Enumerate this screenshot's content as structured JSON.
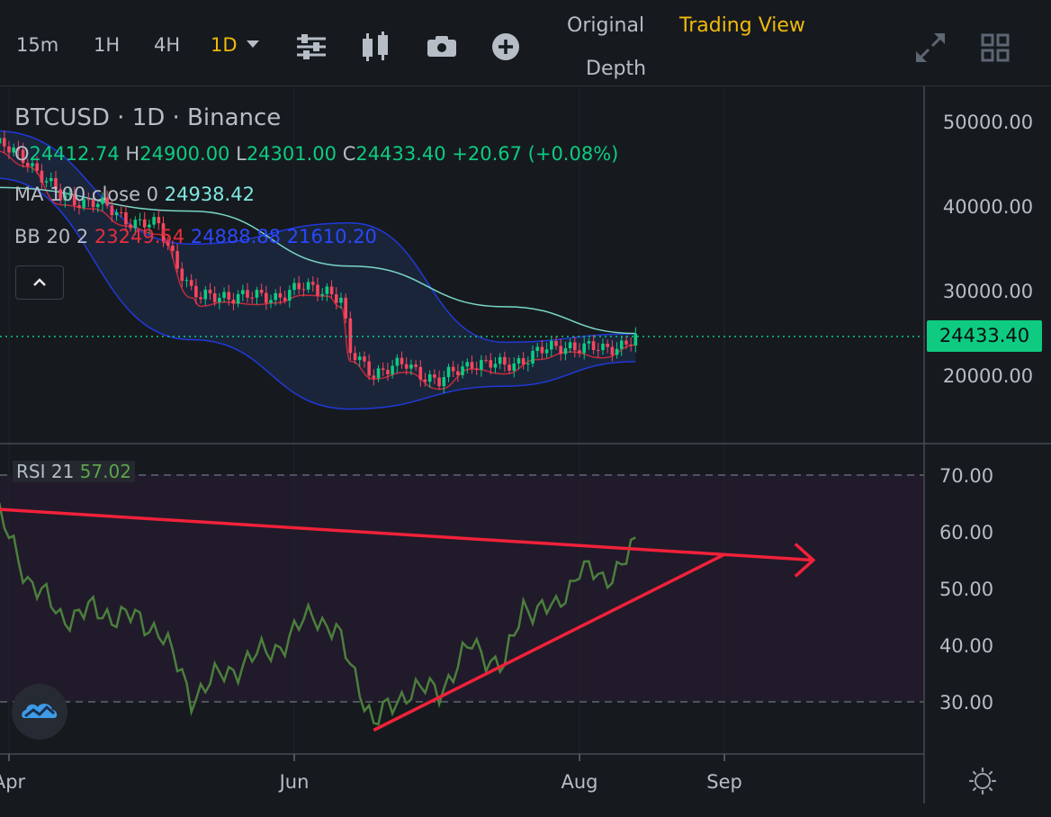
{
  "toolbar": {
    "intervals": [
      "15m",
      "1H",
      "4H",
      "1D"
    ],
    "active_interval": "1D",
    "icons": [
      "indicator-settings-icon",
      "candle-type-icon",
      "screenshot-icon",
      "add-indicator-icon"
    ],
    "views": {
      "original": "Original",
      "trading_view": "Trading View",
      "depth": "Depth"
    },
    "right_icons": [
      "fullscreen-icon",
      "layout-grid-icon"
    ]
  },
  "legend": {
    "symbol": "BTCUSD · 1D · Binance",
    "ohlc": {
      "o_label": "O",
      "o": "24412.74",
      "h_label": "H",
      "h": "24900.00",
      "l_label": "L",
      "l": "24301.00",
      "c_label": "C",
      "c": "24433.40",
      "change": "+20.67 (+0.08%)"
    },
    "ma": {
      "label": "MA 100 close 0",
      "value": "24938.42"
    },
    "bb": {
      "label": "BB 20 2",
      "basis": "23249.54",
      "upper": "24888.88",
      "lower": "21610.20"
    },
    "rsi": {
      "label": "RSI 21",
      "value": "57.02"
    }
  },
  "last_price": "24433.40",
  "colors": {
    "up": "#0ecb81",
    "down": "#f6465d",
    "ma": "#7ad7c8",
    "bb_band": "#2139d8",
    "bb_basis": "#c22b3a",
    "rsi": "#4b7f3d",
    "annotation": "#f2213a",
    "accent": "#f0b90b"
  },
  "chart_data": [
    {
      "type": "candlestick",
      "title": "BTCUSD · 1D · Binance",
      "x_ticks": [
        "Apr",
        "Jun",
        "Aug",
        "Sep"
      ],
      "y_ticks": [
        "50000.00",
        "40000.00",
        "30000.00",
        "20000.00"
      ],
      "ylim": [
        13000,
        53000
      ],
      "series": [
        {
          "name": "close",
          "x": [
            "2022-03-29",
            "2022-04-05",
            "2022-04-12",
            "2022-04-19",
            "2022-04-26",
            "2022-05-03",
            "2022-05-10",
            "2022-05-12",
            "2022-05-17",
            "2022-05-24",
            "2022-05-28",
            "2022-06-03",
            "2022-06-08",
            "2022-06-11",
            "2022-06-13",
            "2022-06-18",
            "2022-06-25",
            "2022-07-02",
            "2022-07-09",
            "2022-07-16",
            "2022-07-23",
            "2022-07-30",
            "2022-08-06",
            "2022-08-13"
          ],
          "values": [
            47400,
            45500,
            41000,
            40500,
            38500,
            37500,
            30000,
            29000,
            29500,
            29200,
            29400,
            30300,
            30200,
            28900,
            22500,
            20400,
            21200,
            19200,
            21600,
            21000,
            22700,
            23600,
            22900,
            24433
          ]
        },
        {
          "name": "MA 100 close 0",
          "x": [
            "2022-03-29",
            "2022-05-10",
            "2022-06-13",
            "2022-07-16",
            "2022-08-13"
          ],
          "values": [
            42200,
            39400,
            32900,
            28100,
            24938
          ]
        },
        {
          "name": "BB upper",
          "x": [
            "2022-03-29",
            "2022-05-10",
            "2022-06-13",
            "2022-07-16",
            "2022-08-13"
          ],
          "values": [
            48900,
            35500,
            38000,
            23900,
            24889
          ]
        },
        {
          "name": "BB lower",
          "x": [
            "2022-03-29",
            "2022-05-10",
            "2022-06-13",
            "2022-07-16",
            "2022-08-13"
          ],
          "values": [
            43300,
            24200,
            16000,
            18700,
            21610
          ]
        }
      ]
    },
    {
      "type": "line",
      "title": "RSI 21",
      "x_ticks": [
        "Apr",
        "Jun",
        "Aug",
        "Sep"
      ],
      "y_ticks": [
        "70.00",
        "60.00",
        "50.00",
        "40.00",
        "30.00"
      ],
      "ylim": [
        22,
        73
      ],
      "reference_lines": [
        70,
        30
      ],
      "series": [
        {
          "name": "RSI 21",
          "x": [
            "2022-03-29",
            "2022-04-05",
            "2022-04-12",
            "2022-04-19",
            "2022-04-26",
            "2022-05-03",
            "2022-05-10",
            "2022-05-17",
            "2022-05-24",
            "2022-05-31",
            "2022-06-05",
            "2022-06-10",
            "2022-06-15",
            "2022-06-18",
            "2022-06-25",
            "2022-07-02",
            "2022-07-09",
            "2022-07-16",
            "2022-07-20",
            "2022-07-27",
            "2022-08-01",
            "2022-08-06",
            "2022-08-10",
            "2022-08-13"
          ],
          "values": [
            64,
            52,
            45,
            46,
            45,
            43,
            31,
            35,
            38,
            41,
            46,
            42,
            33,
            26,
            32,
            32,
            40,
            36,
            47,
            46,
            54,
            51,
            55,
            57
          ]
        },
        {
          "name": "trendline-upper",
          "x": [
            "2022-03-29",
            "2022-09-20"
          ],
          "values": [
            64,
            55
          ]
        },
        {
          "name": "trendline-lower",
          "x": [
            "2022-06-18",
            "2022-09-01"
          ],
          "values": [
            25,
            56
          ]
        }
      ]
    }
  ]
}
